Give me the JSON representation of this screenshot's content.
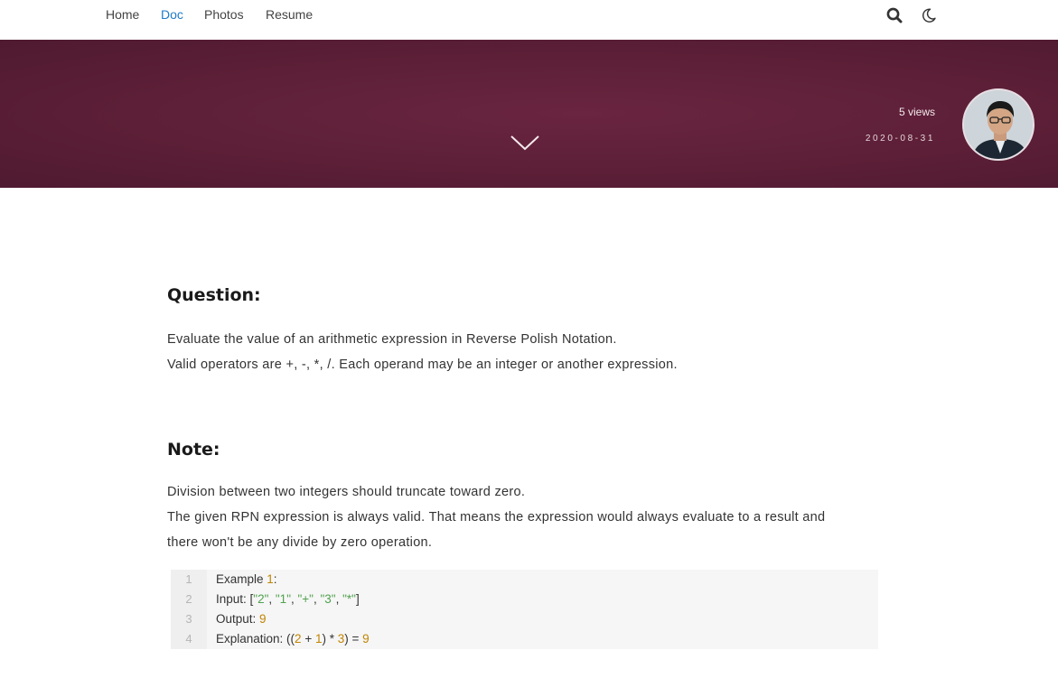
{
  "nav": {
    "items": [
      {
        "label": "Home",
        "active": false
      },
      {
        "label": "Doc",
        "active": true
      },
      {
        "label": "Photos",
        "active": false
      },
      {
        "label": "Resume",
        "active": false
      }
    ],
    "icons": [
      "search-icon",
      "moon-icon"
    ]
  },
  "hero": {
    "views": "5 views",
    "date": "2020-08-31",
    "background_color": "#5c1f37"
  },
  "article": {
    "question_heading": "Question:",
    "question_lines": [
      "Evaluate the value of an arithmetic expression in Reverse Polish Notation.",
      "Valid operators are +, -, *, /. Each operand may be an integer or another expression."
    ],
    "note_heading": "Note:",
    "note_lines": [
      "Division between two integers should truncate toward zero.",
      "The given RPN expression is always valid. That means the expression would always evaluate to a result and",
      "there won't be any divide by zero operation."
    ]
  },
  "code": {
    "line_numbers": [
      "1",
      "2",
      "3",
      "4"
    ],
    "lines": {
      "l1_prefix": "Example ",
      "l1_num": "1",
      "l1_suffix": ":",
      "l2_prefix": "Input: [",
      "l2_s1": "\"2\"",
      "l2_s2": "\"1\"",
      "l2_s3": "\"+\"",
      "l2_s4": "\"3\"",
      "l2_s5": "\"*\"",
      "l2_sep": ", ",
      "l2_suffix": "]",
      "l3_prefix": "Output: ",
      "l3_num": "9",
      "l4_prefix": "Explanation: ((",
      "l4_n1": "2",
      "l4_op1": " + ",
      "l4_n2": "1",
      "l4_op2": ") * ",
      "l4_n3": "3",
      "l4_op3": ") = ",
      "l4_n4": "9"
    },
    "colors": {
      "number": "#c18401",
      "string": "#50a14f"
    }
  }
}
